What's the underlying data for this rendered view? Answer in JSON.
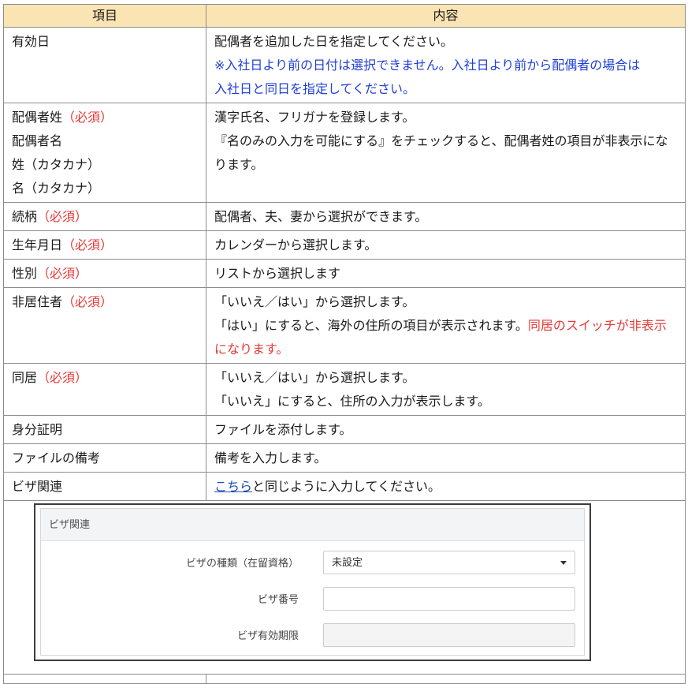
{
  "headers": {
    "item": "項目",
    "content": "内容"
  },
  "rows": [
    {
      "item_lines": [
        {
          "text": "有効日",
          "req": ""
        }
      ],
      "content_lines": [
        {
          "text": "配偶者を追加した日を指定してください。",
          "tail": "",
          "style": ""
        },
        {
          "text": "※入社日より前の日付は選択できません。入社日より前から配偶者の場合は",
          "tail": "",
          "style": "blue"
        },
        {
          "text": "入社日と同日を指定してください。",
          "tail": "",
          "style": "blue"
        }
      ]
    },
    {
      "item_lines": [
        {
          "text": "配偶者姓",
          "req": "（必須）"
        },
        {
          "text": "配偶者名",
          "req": ""
        },
        {
          "text": "姓（カタカナ）",
          "req": ""
        },
        {
          "text": "名（カタカナ）",
          "req": ""
        }
      ],
      "content_lines": [
        {
          "text": "漢字氏名、フリガナを登録します。",
          "tail": "",
          "style": ""
        },
        {
          "text": "『名のみの入力を可能にする』をチェックすると、配偶者姓の項目が非表示にな",
          "tail": "",
          "style": ""
        },
        {
          "text": "ります。",
          "tail": "",
          "style": ""
        }
      ]
    },
    {
      "item_lines": [
        {
          "text": "続柄",
          "req": "（必須）"
        }
      ],
      "content_lines": [
        {
          "text": "配偶者、夫、妻から選択ができます。",
          "tail": "",
          "style": ""
        }
      ]
    },
    {
      "item_lines": [
        {
          "text": "生年月日",
          "req": "（必須）"
        }
      ],
      "content_lines": [
        {
          "text": "カレンダーから選択します。",
          "tail": "",
          "style": ""
        }
      ]
    },
    {
      "item_lines": [
        {
          "text": "性別",
          "req": "（必須）"
        }
      ],
      "content_lines": [
        {
          "text": "リストから選択します",
          "tail": "",
          "style": ""
        }
      ]
    },
    {
      "item_lines": [
        {
          "text": "非居住者",
          "req": "（必須）"
        }
      ],
      "content_lines": [
        {
          "text": "「いいえ／はい」から選択します。",
          "tail": "",
          "style": ""
        },
        {
          "text": "「はい」にすると、海外の住所の項目が表示されます。",
          "tail": "同居のスイッチが非表示",
          "style": ""
        },
        {
          "text": "になります。",
          "tail": "",
          "style": "red"
        }
      ]
    },
    {
      "item_lines": [
        {
          "text": "同居",
          "req": "（必須）"
        }
      ],
      "content_lines": [
        {
          "text": "「いいえ／はい」から選択します。",
          "tail": "",
          "style": ""
        },
        {
          "text": "「いいえ」にすると、住所の入力が表示します。",
          "tail": "",
          "style": ""
        }
      ]
    },
    {
      "item_lines": [
        {
          "text": "身分証明",
          "req": ""
        }
      ],
      "content_lines": [
        {
          "text": "ファイルを添付します。",
          "tail": "",
          "style": ""
        }
      ]
    },
    {
      "item_lines": [
        {
          "text": "ファイルの備考",
          "req": ""
        }
      ],
      "content_lines": [
        {
          "text": "備考を入力します。",
          "tail": "",
          "style": ""
        }
      ]
    }
  ],
  "visa_row": {
    "item": "ビザ関連",
    "link_text": "こちら",
    "content_rest": "と同じように入力してください。"
  },
  "visa_panel": {
    "header": "ビザ関連",
    "type_label": "ビザの種類（在留資格）",
    "type_value": "未設定",
    "number_label": "ビザ番号",
    "number_value": "",
    "expiry_label": "ビザ有効期限",
    "expiry_value": ""
  },
  "colors": {
    "header_bg": "#fbe4b3",
    "required_red": "#e53935",
    "note_blue": "#1f3fd6",
    "link_blue": "#1f4eb5"
  }
}
